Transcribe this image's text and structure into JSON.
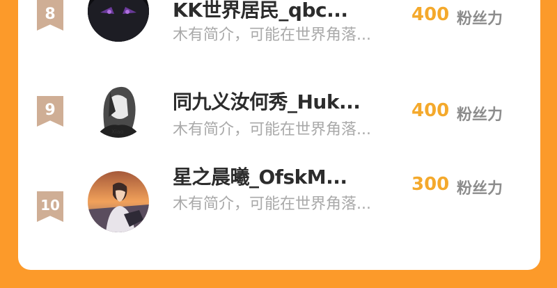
{
  "list": [
    {
      "rank": "8",
      "name": "KK世界居民_qbc...",
      "bio": "木有简介，可能在世界角落...",
      "count": "400",
      "unit": "粉丝力",
      "avatar_icon": "dark-anime-avatar"
    },
    {
      "rank": "9",
      "name": "同九义汝何秀_Huk...",
      "bio": "木有简介，可能在世界角落...",
      "count": "400",
      "unit": "粉丝力",
      "avatar_icon": "sketch-anime-avatar"
    },
    {
      "rank": "10",
      "name": "星之晨曦_OfskM...",
      "bio": "木有简介，可能在世界角落...",
      "count": "300",
      "unit": "粉丝力",
      "avatar_icon": "sunset-boy-avatar"
    }
  ],
  "colors": {
    "background": "#fc9a2a",
    "rank_badge": "#cfae95",
    "count": "#f4a92c"
  }
}
